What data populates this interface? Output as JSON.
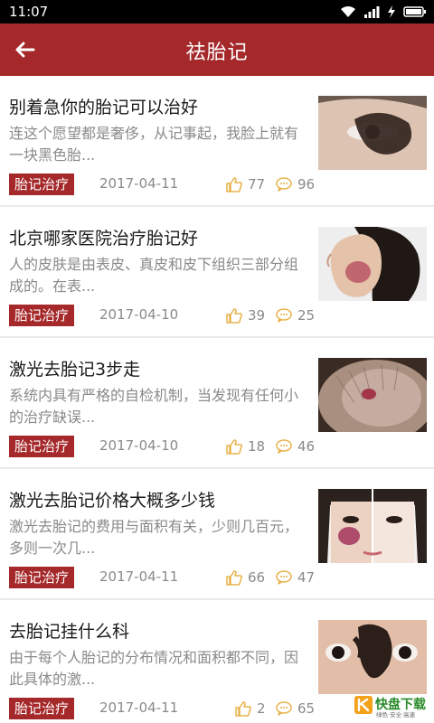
{
  "status_bar": {
    "time": "11:07"
  },
  "header": {
    "title": "祛胎记",
    "back_icon": "back-arrow-icon"
  },
  "colors": {
    "brand": "#a5282a",
    "icon_gold": "#e7b24a",
    "meta_gray": "#8a8a8a"
  },
  "articles": [
    {
      "title": "别着急你的胎记可以治好",
      "excerpt": "连这个愿望都是奢侈，从记事起，我脸上就有一块黑色胎...",
      "tag": "胎记治疗",
      "date": "2017-04-11",
      "likes": "77",
      "comments": "96",
      "thumbnail": "eye-dark-birthmark"
    },
    {
      "title": "北京哪家医院治疗胎记好",
      "excerpt": "人的皮肤是由表皮、真皮和皮下组织三部分组成的。在表...",
      "tag": "胎记治疗",
      "date": "2017-04-10",
      "likes": "39",
      "comments": "25",
      "thumbnail": "woman-cheek-birthmark"
    },
    {
      "title": "激光去胎记3步走",
      "excerpt": "系统内具有严格的自检机制，当发现有任何小的治疗缺误...",
      "tag": "胎记治疗",
      "date": "2017-04-10",
      "likes": "18",
      "comments": "46",
      "thumbnail": "baby-head-birthmark"
    },
    {
      "title": "激光去胎记价格大概多少钱",
      "excerpt": "激光去胎记的费用与面积有关，少则几百元，多则一次几...",
      "tag": "胎记治疗",
      "date": "2017-04-11",
      "likes": "66",
      "comments": "47",
      "thumbnail": "face-before-after"
    },
    {
      "title": "去胎记挂什么科",
      "excerpt": "由于每个人胎记的分布情况和面积都不同，因此具体的激...",
      "tag": "胎记治疗",
      "date": "2017-04-11",
      "likes": "2",
      "comments": "65",
      "thumbnail": "eyes-dark-birthmark"
    }
  ],
  "watermark": {
    "brand": "快盘下载",
    "tagline": "绿色·安全·高速"
  }
}
